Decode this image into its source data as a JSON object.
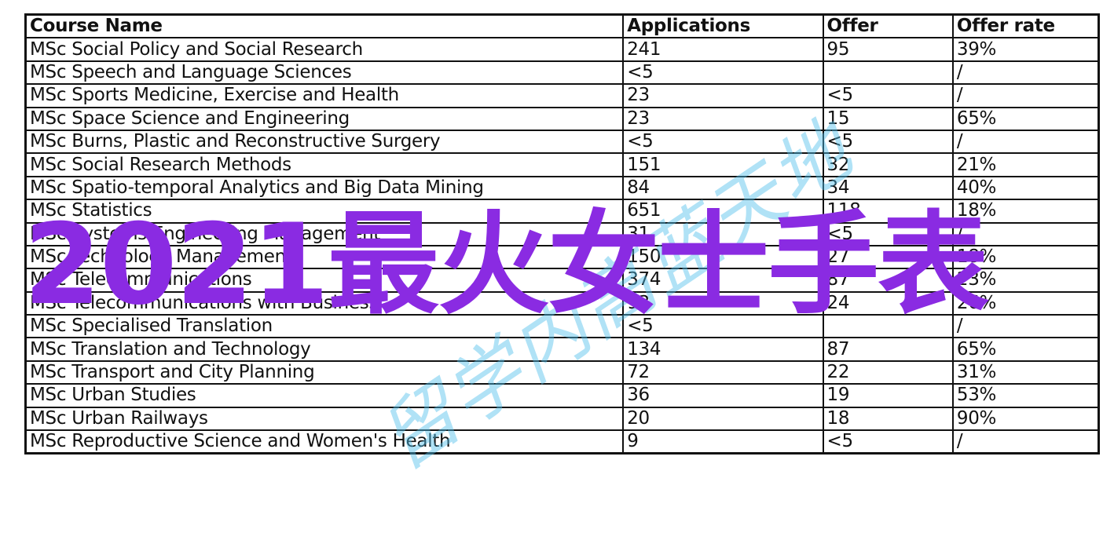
{
  "table": {
    "headers": [
      "Course Name",
      "Applications",
      "Offer",
      "Offer rate"
    ],
    "rows": [
      [
        "MSc Social Policy and Social Research",
        "241",
        "95",
        "39%"
      ],
      [
        "MSc Speech and Language Sciences",
        "<5",
        "",
        "/"
      ],
      [
        "MSc Sports Medicine, Exercise and Health",
        "23",
        "<5",
        "/"
      ],
      [
        "MSc Space Science and Engineering",
        "23",
        "15",
        "65%"
      ],
      [
        "MSc Burns, Plastic and Reconstructive Surgery",
        "<5",
        "<5",
        "/"
      ],
      [
        "MSc Social Research Methods",
        "151",
        "32",
        "21%"
      ],
      [
        "MSc Spatio-temporal Analytics and Big Data Mining",
        "84",
        "34",
        "40%"
      ],
      [
        "MSc Statistics",
        "651",
        "118",
        "18%"
      ],
      [
        "MSc Systems Engineering Management",
        "31",
        "<5",
        "/"
      ],
      [
        "MSc Technology Management",
        "150",
        "27",
        "18%"
      ],
      [
        "MSc Telecommunications",
        "374",
        "87",
        "23%"
      ],
      [
        "MSc Telecommunications with Business",
        "93",
        "24",
        "26%"
      ],
      [
        "MSc Specialised Translation",
        "<5",
        "",
        "/"
      ],
      [
        "MSc Translation and Technology",
        "134",
        "87",
        "65%"
      ],
      [
        "MSc Transport and City Planning",
        "72",
        "22",
        "31%"
      ],
      [
        "MSc Urban Studies",
        "36",
        "19",
        "53%"
      ],
      [
        "MSc Urban Railways",
        "20",
        "18",
        "90%"
      ],
      [
        "MSc Reproductive Science and Women's Health",
        "9",
        "<5",
        "/"
      ]
    ]
  },
  "overlay_text": "2021最火女士手表",
  "watermark": "留学内高蓝天地",
  "colors": {
    "overlay": "#8a2be2",
    "watermark": "#50bee b"
  }
}
